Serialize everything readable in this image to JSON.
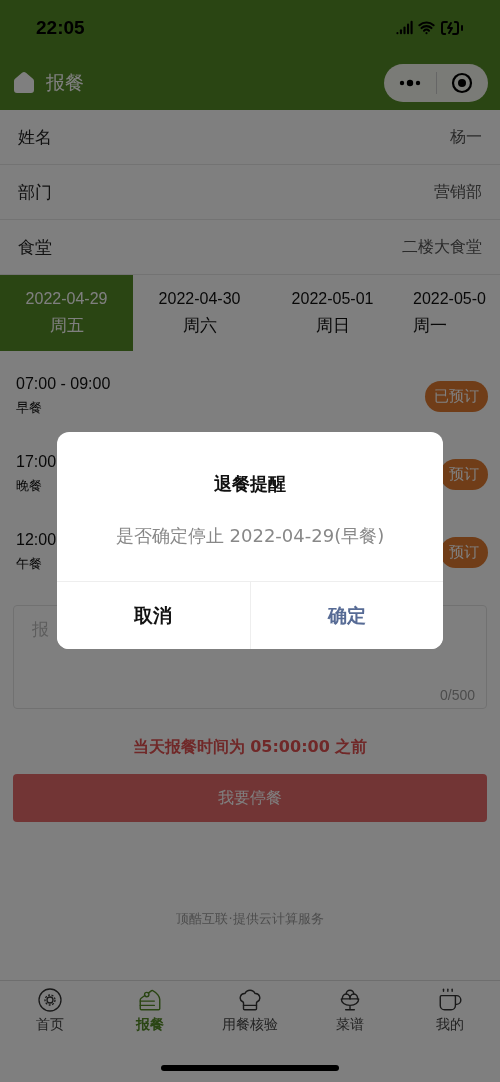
{
  "status_bar": {
    "time": "22:05"
  },
  "nav": {
    "title": "报餐"
  },
  "info_rows": [
    {
      "label": "姓名",
      "value": "杨一"
    },
    {
      "label": "部门",
      "value": "营销部"
    },
    {
      "label": "食堂",
      "value": "二楼大食堂"
    }
  ],
  "date_tabs": [
    {
      "date": "2022-04-29",
      "weekday": "周五",
      "selected": true
    },
    {
      "date": "2022-04-30",
      "weekday": "周六",
      "selected": false
    },
    {
      "date": "2022-05-01",
      "weekday": "周日",
      "selected": false
    },
    {
      "date": "2022-05-0",
      "weekday": "周一",
      "selected": false
    }
  ],
  "meals": [
    {
      "time": "07:00 - 09:00",
      "name": "早餐",
      "badge": "已预订"
    },
    {
      "time": "17:00",
      "name": "晚餐",
      "badge": "预订"
    },
    {
      "time": "12:00",
      "name": "午餐",
      "badge": "预订"
    }
  ],
  "remark": {
    "placeholder": "报",
    "counter": "0/500"
  },
  "notice": "当天报餐时间为 05:00:00 之前",
  "stop_button": "我要停餐",
  "footer": "顶酷互联·提供云计算服务",
  "tab_bar": [
    {
      "kind": "donut",
      "label": "首页",
      "selected": false
    },
    {
      "kind": "cake",
      "label": "报餐",
      "selected": true
    },
    {
      "kind": "chef",
      "label": "用餐核验",
      "selected": false
    },
    {
      "kind": "icecream",
      "label": "菜谱",
      "selected": false
    },
    {
      "kind": "cup",
      "label": "我的",
      "selected": false
    }
  ],
  "dialog": {
    "title": "退餐提醒",
    "message": "是否确定停止 2022-04-29(早餐)",
    "cancel": "取消",
    "confirm": "确定"
  }
}
